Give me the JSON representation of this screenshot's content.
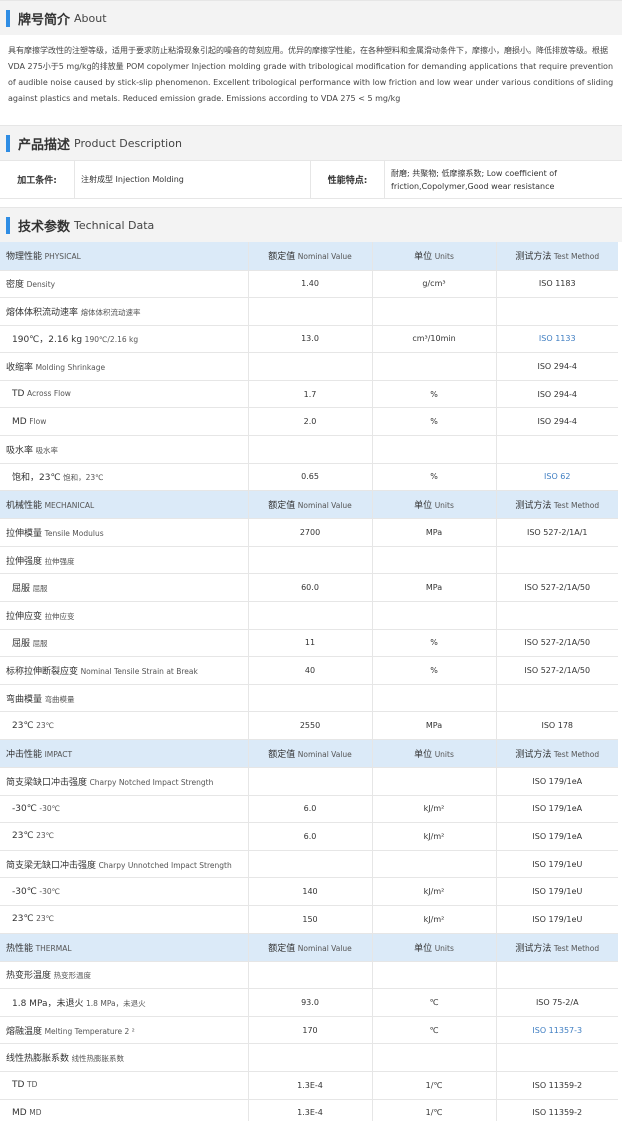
{
  "about": {
    "title_zh": "牌号简介",
    "title_en": "About",
    "text": "具有摩擦学改性的注塑等级，适用于要求防止粘滑现象引起的噪音的苛刻应用。优异的摩擦学性能，在各种塑料和金属滑动条件下，摩擦小，磨损小。降低排放等级。根据VDA 275小于5 mg/kg的排放量   POM copolymer Injection molding grade with tribological modification for demanding applications that require prevention of audible noise caused by stick-slip phenomenon. Excellent tribological performance with low friction and low wear under various conditions of sliding against plastics and metals. Reduced emission grade. Emissions according to VDA 275 < 5 mg/kg"
  },
  "product": {
    "title_zh": "产品描述",
    "title_en": "Product Description",
    "proc_label": "加工条件:",
    "proc_value": "注射成型  Injection Molding",
    "feat_label": "性能特点:",
    "feat_value": "耐磨; 共聚物; 低摩擦系数;   Low coefficient of friction,Copolymer,Good wear resistance"
  },
  "tech": {
    "title_zh": "技术参数",
    "title_en": "Technical Data"
  },
  "rows": [
    {
      "type": "hdr",
      "zh": "物理性能",
      "en": "PHYSICAL",
      "v_zh": "额定值",
      "v_en": "Nominal Value",
      "u_zh": "单位",
      "u_en": "Units",
      "m_zh": "测试方法",
      "m_en": "Test Method"
    },
    {
      "zh": "密度",
      "en": "Density",
      "v": "1.40",
      "u": "g/cm³",
      "m": "ISO 1183"
    },
    {
      "zh": "熔体体积流动速率",
      "en": "熔体体积流动速率",
      "v": "",
      "u": "",
      "m": ""
    },
    {
      "sub": true,
      "zh": "190℃，2.16 kg",
      "en": "190℃/2.16 kg",
      "v": "13.0",
      "u": "cm³/10min",
      "m": "ISO 1133",
      "link": true
    },
    {
      "zh": "收缩率",
      "en": "Molding Shrinkage",
      "v": "",
      "u": "",
      "m": "ISO 294-4"
    },
    {
      "sub": true,
      "zh": "TD",
      "en": "Across Flow",
      "v": "1.7",
      "u": "%",
      "m": "ISO 294-4"
    },
    {
      "sub": true,
      "zh": "MD",
      "en": "Flow",
      "v": "2.0",
      "u": "%",
      "m": "ISO 294-4"
    },
    {
      "zh": "吸水率",
      "en": "吸水率",
      "v": "",
      "u": "",
      "m": ""
    },
    {
      "sub": true,
      "zh": "饱和，23℃",
      "en": "饱和，23℃",
      "v": "0.65",
      "u": "%",
      "m": "ISO 62",
      "link": true
    },
    {
      "type": "hdr",
      "zh": "机械性能",
      "en": "MECHANICAL",
      "v_zh": "额定值",
      "v_en": "Nominal Value",
      "u_zh": "单位",
      "u_en": "Units",
      "m_zh": "测试方法",
      "m_en": "Test Method"
    },
    {
      "zh": "拉伸模量",
      "en": "Tensile Modulus",
      "v": "2700",
      "u": "MPa",
      "m": "ISO 527-2/1A/1"
    },
    {
      "zh": "拉伸强度",
      "en": "拉伸强度",
      "v": "",
      "u": "",
      "m": ""
    },
    {
      "sub": true,
      "zh": "屈服",
      "en": "屈服",
      "v": "60.0",
      "u": "MPa",
      "m": "ISO 527-2/1A/50"
    },
    {
      "zh": "拉伸应变",
      "en": "拉伸应变",
      "v": "",
      "u": "",
      "m": ""
    },
    {
      "sub": true,
      "zh": "屈服",
      "en": "屈服",
      "v": "11",
      "u": "%",
      "m": "ISO 527-2/1A/50"
    },
    {
      "zh": "标称拉伸断裂应变",
      "en": "Nominal Tensile Strain at Break",
      "v": "40",
      "u": "%",
      "m": "ISO 527-2/1A/50"
    },
    {
      "zh": "弯曲模量",
      "en": "弯曲模量",
      "v": "",
      "u": "",
      "m": ""
    },
    {
      "sub": true,
      "zh": "23℃",
      "en": "23℃",
      "v": "2550",
      "u": "MPa",
      "m": "ISO 178"
    },
    {
      "type": "hdr",
      "zh": "冲击性能",
      "en": "IMPACT",
      "v_zh": "额定值",
      "v_en": "Nominal Value",
      "u_zh": "单位",
      "u_en": "Units",
      "m_zh": "测试方法",
      "m_en": "Test Method"
    },
    {
      "zh": "简支梁缺口冲击强度",
      "en": "Charpy Notched Impact Strength",
      "v": "",
      "u": "",
      "m": "ISO 179/1eA"
    },
    {
      "sub": true,
      "zh": "-30℃",
      "en": "-30℃",
      "v": "6.0",
      "u": "kJ/m²",
      "m": "ISO 179/1eA"
    },
    {
      "sub": true,
      "zh": "23℃",
      "en": "23℃",
      "v": "6.0",
      "u": "kJ/m²",
      "m": "ISO 179/1eA"
    },
    {
      "zh": "简支梁无缺口冲击强度",
      "en": "Charpy Unnotched Impact Strength",
      "v": "",
      "u": "",
      "m": "ISO 179/1eU"
    },
    {
      "sub": true,
      "zh": "-30℃",
      "en": "-30℃",
      "v": "140",
      "u": "kJ/m²",
      "m": "ISO 179/1eU"
    },
    {
      "sub": true,
      "zh": "23℃",
      "en": "23℃",
      "v": "150",
      "u": "kJ/m²",
      "m": "ISO 179/1eU"
    },
    {
      "type": "hdr",
      "zh": "热性能",
      "en": "THERMAL",
      "v_zh": "额定值",
      "v_en": "Nominal Value",
      "u_zh": "单位",
      "u_en": "Units",
      "m_zh": "测试方法",
      "m_en": "Test Method"
    },
    {
      "zh": "热变形温度",
      "en": "热变形温度",
      "v": "",
      "u": "",
      "m": ""
    },
    {
      "sub": true,
      "zh": "1.8 MPa，未退火",
      "en": "1.8 MPa，未退火",
      "v": "93.0",
      "u": "℃",
      "m": "ISO 75-2/A"
    },
    {
      "zh": "熔融温度",
      "en": "Melting Temperature   2 ²",
      "v": "170",
      "u": "℃",
      "m": "ISO 11357-3",
      "link": true
    },
    {
      "zh": "线性热膨胀系数",
      "en": "线性热膨胀系数",
      "v": "",
      "u": "",
      "m": ""
    },
    {
      "sub": true,
      "zh": "TD",
      "en": "TD",
      "v": "1.3E-4",
      "u": "1/℃",
      "m": "ISO 11359-2"
    },
    {
      "sub": true,
      "zh": "MD",
      "en": "MD",
      "v": "1.3E-4",
      "u": "1/℃",
      "m": "ISO 11359-2"
    }
  ]
}
